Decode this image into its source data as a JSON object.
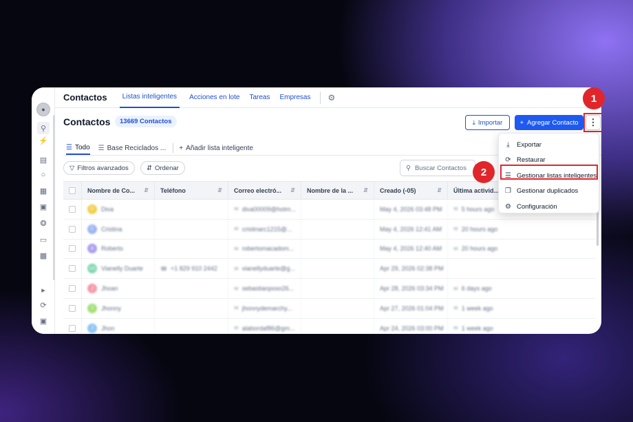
{
  "app": {
    "title": "Contactos",
    "tabs": [
      {
        "label": "Listas inteligentes",
        "active": true
      },
      {
        "label": "Acciones en lote"
      },
      {
        "label": "Tareas"
      },
      {
        "label": "Empresas"
      }
    ],
    "settings_icon": "gear-icon"
  },
  "header": {
    "title": "Contactos",
    "count_badge": "13669 Contactos",
    "import_label": "Importar",
    "add_label": "Agregar Contacto",
    "more_icon": "⋮"
  },
  "lists": {
    "tabs": [
      {
        "label": "Todo",
        "active": true
      },
      {
        "label": "Base Reciclados ..."
      }
    ],
    "add_label": "Añadir lista inteligente"
  },
  "filters": {
    "advanced_label": "Filtros avanzados",
    "sort_label": "Ordenar",
    "search_placeholder": "Buscar Contactos"
  },
  "table": {
    "columns": [
      "Nombre de Co...",
      "Teléfono",
      "Correo electró...",
      "Nombre de la ...",
      "Creado (-05)",
      "Última activid..."
    ],
    "rows": [
      {
        "initial": "D",
        "name": "Diva",
        "phone": "",
        "email": "diva00009@hotm...",
        "created": "May 4, 2026 03:48 PM",
        "activity": "5 hours ago",
        "color": "#f2cf4a"
      },
      {
        "initial": "C",
        "name": "Cristina",
        "phone": "",
        "email": "cristinarc1215@...",
        "created": "May 4, 2026 12:41 AM",
        "activity": "20 hours ago",
        "color": "#9db5f2"
      },
      {
        "initial": "R",
        "name": "Roberto",
        "phone": "",
        "email": "robertomacadom...",
        "created": "May 4, 2026 12:40 AM",
        "activity": "20 hours ago",
        "color": "#a89ef0"
      },
      {
        "initial": "VD",
        "name": "Vianelly Duarte",
        "phone": "+1 829 910 2442",
        "email": "vianellyduarte@g...",
        "created": "Apr 29, 2026 02:38 PM",
        "activity": "",
        "color": "#7ed6b0"
      },
      {
        "initial": "J",
        "name": "Jhoan",
        "phone": "",
        "email": "sebastianposo26...",
        "created": "Apr 28, 2026 03:34 PM",
        "activity": "6 days ago",
        "color": "#f59aa8"
      },
      {
        "initial": "J",
        "name": "Jhonny",
        "phone": "",
        "email": "jhonnydemarchy...",
        "created": "Apr 27, 2026 01:04 PM",
        "activity": "1 week ago",
        "color": "#a6e07a"
      },
      {
        "initial": "J",
        "name": "Jhon",
        "phone": "",
        "email": "alabordaf86@gm...",
        "created": "Apr 24, 2026 03:00 PM",
        "activity": "1 week ago",
        "color": "#8ec6f2"
      }
    ]
  },
  "menu": {
    "items": [
      {
        "label": "Exportar",
        "icon": "⤓",
        "icon_name": "export-icon"
      },
      {
        "label": "Restaurar",
        "icon": "⟳",
        "icon_name": "restore-icon"
      },
      {
        "label": "Gestionar listas inteligentes",
        "icon": "☰",
        "icon_name": "list-icon"
      },
      {
        "label": "Gestionar duplicados",
        "icon": "❐",
        "icon_name": "duplicate-icon"
      },
      {
        "label": "Configuración",
        "icon": "⚙",
        "icon_name": "settings-icon"
      }
    ]
  },
  "steps": {
    "one": "1",
    "two": "2"
  },
  "colors": {
    "accent": "#1f5af0",
    "highlight": "#e0262b"
  }
}
